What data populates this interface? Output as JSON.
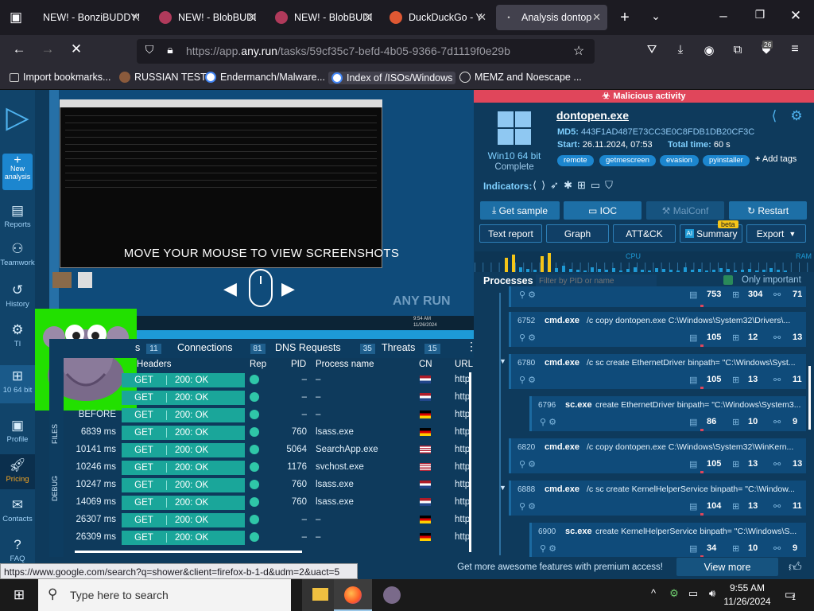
{
  "browser": {
    "tabs": [
      {
        "title": "NEW! - BonziBUDDY!"
      },
      {
        "title": "NEW! - BlobBUDDY"
      },
      {
        "title": "NEW! - BlobBUDDY"
      },
      {
        "title": "DuckDuckGo - Y"
      },
      {
        "title": "Analysis dontop"
      }
    ],
    "new_tab": "+",
    "url_prefix": "https://app.",
    "url_domain": "any.run",
    "url_path": "/tasks/59cf35c7-befd-4b05-9366-7d1119f0e29b",
    "profile_badge": "26",
    "bookmarks": [
      {
        "label": "Import bookmarks..."
      },
      {
        "label": "RUSSIAN TEST"
      },
      {
        "label": "Endermanch/Malware..."
      },
      {
        "label": "Index of /ISOs/Windows"
      },
      {
        "label": "MEMZ and Noescape ..."
      }
    ]
  },
  "sidebar": {
    "items": [
      {
        "label": "New analysis",
        "icon": "plus-icon"
      },
      {
        "label": "Reports",
        "icon": "reports-icon"
      },
      {
        "label": "Teamwork",
        "icon": "teamwork-icon"
      },
      {
        "label": "History",
        "icon": "history-icon"
      },
      {
        "label": "TI",
        "icon": "ti-icon"
      },
      {
        "label": "10 64 bit",
        "icon": "windows-icon"
      },
      {
        "label": "Profile",
        "icon": "profile-icon"
      },
      {
        "label": "Pricing",
        "icon": "rocket-icon"
      },
      {
        "label": "Contacts",
        "icon": "mail-icon"
      },
      {
        "label": "FAQ",
        "icon": "help-icon"
      }
    ]
  },
  "vm": {
    "overlay_text": "MOVE YOUR MOUSE TO VIEW SCREENSHOTS",
    "watermark": "ANY RUN",
    "clock_time": "9:54 AM",
    "clock_date": "11/26/2024"
  },
  "network": {
    "tabs": [
      {
        "label": "HTTP Requests",
        "visible": "s",
        "count": "11"
      },
      {
        "label": "Connections",
        "count": "81"
      },
      {
        "label": "DNS Requests",
        "count": "35"
      },
      {
        "label": "Threats",
        "count": "15"
      }
    ],
    "side_tabs": [
      "FILES",
      "DEBUG"
    ],
    "headers": {
      "headers": "Headers",
      "rep": "Rep",
      "pid": "PID",
      "process": "Process name",
      "cn": "CN",
      "url": "URL"
    },
    "rows": [
      {
        "time": "",
        "method": "GET",
        "status": "200: OK",
        "pid": "–",
        "process": "–",
        "flag": "nl",
        "url": "http"
      },
      {
        "time": "",
        "method": "GET",
        "status": "200: OK",
        "pid": "–",
        "process": "–",
        "flag": "nl",
        "url": "http"
      },
      {
        "time": "BEFORE",
        "method": "GET",
        "status": "200: OK",
        "pid": "–",
        "process": "–",
        "flag": "de",
        "url": "http"
      },
      {
        "time": "6839 ms",
        "method": "GET",
        "status": "200: OK",
        "pid": "760",
        "process": "lsass.exe",
        "flag": "de",
        "url": "http"
      },
      {
        "time": "10141 ms",
        "method": "GET",
        "status": "200: OK",
        "pid": "5064",
        "process": "SearchApp.exe",
        "flag": "us",
        "url": "http"
      },
      {
        "time": "10246 ms",
        "method": "GET",
        "status": "200: OK",
        "pid": "1176",
        "process": "svchost.exe",
        "flag": "us",
        "url": "http"
      },
      {
        "time": "10247 ms",
        "method": "GET",
        "status": "200: OK",
        "pid": "760",
        "process": "lsass.exe",
        "flag": "nl",
        "url": "http"
      },
      {
        "time": "14069 ms",
        "method": "GET",
        "status": "200: OK",
        "pid": "760",
        "process": "lsass.exe",
        "flag": "nl",
        "url": "http"
      },
      {
        "time": "26307 ms",
        "method": "GET",
        "status": "200: OK",
        "pid": "–",
        "process": "–",
        "flag": "de",
        "url": "http"
      },
      {
        "time": "26309 ms",
        "method": "GET",
        "status": "200: OK",
        "pid": "–",
        "process": "–",
        "flag": "de",
        "url": "http"
      }
    ]
  },
  "analysis": {
    "banner": "Malicious activity",
    "filename": "dontopen.exe",
    "md5_label": "MD5:",
    "md5": "443F1AD487E73CC3E0C8FDB1DB20CF3C",
    "start_label": "Start:",
    "start": "26.11.2024, 07:53",
    "total_label": "Total time:",
    "total": "60 s",
    "os": "Win10 64 bit",
    "os_status": "Complete",
    "tags": [
      "remote",
      "getmescreen",
      "evasion",
      "pyinstaller"
    ],
    "add_tags": "Add tags",
    "indicators_label": "Indicators:",
    "buttons": {
      "get_sample": "Get sample",
      "ioc": "IOC",
      "malconf": "MalConf",
      "restart": "Restart",
      "text_report": "Text report",
      "graph": "Graph",
      "attck": "ATT&CK",
      "summary": "Summary",
      "beta": "beta",
      "export": "Export"
    },
    "cpu_label": "CPU",
    "ram_label": "RAM",
    "processes_label": "Processes",
    "filter_placeholder": "Filter by PID or name",
    "only_important": "Only important",
    "processes": [
      {
        "pid": "",
        "name": "",
        "cmd": "",
        "s1": "753",
        "s2": "304",
        "s3": "71"
      },
      {
        "pid": "6752",
        "name": "cmd.exe",
        "cmd": "/c copy dontopen.exe C:\\Windows\\System32\\Drivers\\...",
        "s1": "105",
        "s2": "12",
        "s3": "13"
      },
      {
        "pid": "6780",
        "name": "cmd.exe",
        "cmd": "/c sc create EthernetDriver binpath= \"C:\\Windows\\Syst...",
        "s1": "105",
        "s2": "13",
        "s3": "11"
      },
      {
        "pid": "6796",
        "name": "sc.exe",
        "cmd": "create EthernetDriver binpath= \"C:\\Windows\\System3...",
        "s1": "86",
        "s2": "10",
        "s3": "9"
      },
      {
        "pid": "6820",
        "name": "cmd.exe",
        "cmd": "/c copy dontopen.exe C:\\Windows\\System32\\WinKern...",
        "s1": "105",
        "s2": "13",
        "s3": "13"
      },
      {
        "pid": "6888",
        "name": "cmd.exe",
        "cmd": "/c sc create KernelHelperService binpath= \"C:\\Window...",
        "s1": "104",
        "s2": "13",
        "s3": "11"
      },
      {
        "pid": "6900",
        "name": "sc.exe",
        "cmd": "create KernelHelperService binpath= \"C:\\Windows\\S...",
        "s1": "34",
        "s2": "10",
        "s3": "9"
      }
    ],
    "premium_text": "Get more awesome features with premium access!",
    "view_more": "View more"
  },
  "status_url": "https://www.google.com/search?q=shower&client=firefox-b-1-d&udm=2&uact=5",
  "taskbar": {
    "search_placeholder": "Type here to search",
    "time": "9:55 AM",
    "date": "11/26/2024",
    "notifications": "1"
  },
  "colors": {
    "malicious": "#e0465b",
    "accent": "#1d6fa6",
    "request_ok": "#1aa69a",
    "panel_bg": "#0e3a5c"
  }
}
